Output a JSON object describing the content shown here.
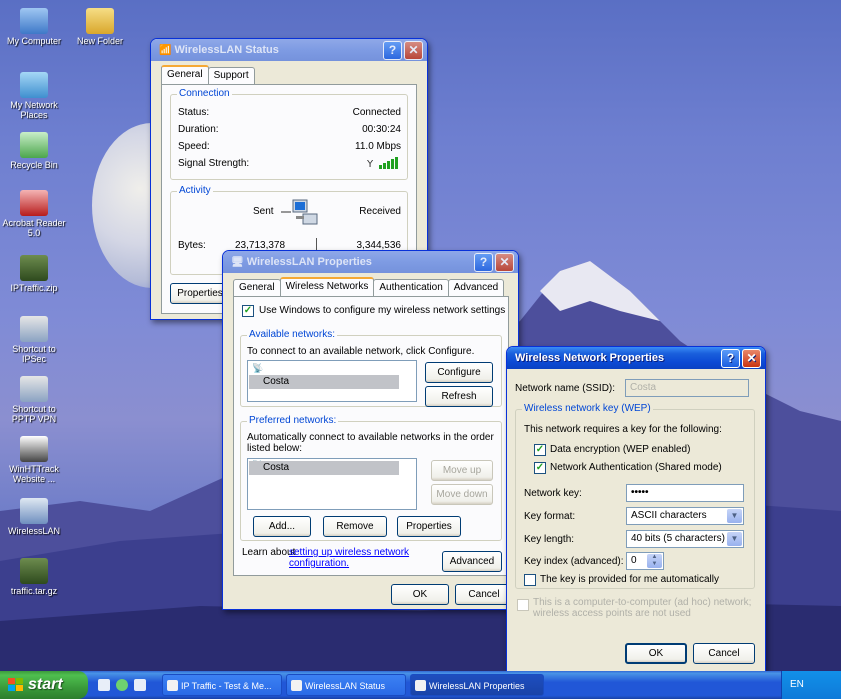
{
  "desktop": {
    "icons": [
      {
        "label": "My Computer"
      },
      {
        "label": "New Folder"
      },
      {
        "label": "My Network Places"
      },
      {
        "label": "Recycle Bin"
      },
      {
        "label": "Acrobat Reader 5.0"
      },
      {
        "label": "IPTraffic.zip"
      },
      {
        "label": "Shortcut to IPSec"
      },
      {
        "label": "Shortcut to PPTP VPN"
      },
      {
        "label": "WinHTTrack Website ..."
      },
      {
        "label": "WirelessLAN"
      },
      {
        "label": "traffic.tar.gz"
      }
    ]
  },
  "status_window": {
    "title": "WirelessLAN Status",
    "tabs": [
      "General",
      "Support"
    ],
    "connection_label": "Connection",
    "rows": [
      {
        "label": "Status:",
        "value": "Connected"
      },
      {
        "label": "Duration:",
        "value": "00:30:24"
      },
      {
        "label": "Speed:",
        "value": "11.0 Mbps"
      },
      {
        "label": "Signal Strength:",
        "value": ""
      }
    ],
    "activity_label": "Activity",
    "sent_label": "Sent",
    "received_label": "Received",
    "bytes_label": "Bytes:",
    "bytes_sent": "23,713,378",
    "bytes_received": "3,344,536",
    "properties_button": "Properties"
  },
  "props_window": {
    "title": "WirelessLAN Properties",
    "tabs": [
      "General",
      "Wireless Networks",
      "Authentication",
      "Advanced"
    ],
    "use_windows_label": "Use Windows to configure my wireless network settings",
    "available_label": "Available networks:",
    "available_text": "To connect to an available network, click Configure.",
    "available_items": [
      "Costa"
    ],
    "configure_button": "Configure",
    "refresh_button": "Refresh",
    "preferred_label": "Preferred networks:",
    "preferred_text": "Automatically connect to available networks in the order listed below:",
    "preferred_items": [
      "Costa"
    ],
    "move_up_button": "Move up",
    "move_down_button": "Move down",
    "add_button": "Add...",
    "remove_button": "Remove",
    "properties_button": "Properties",
    "learn_prefix": "Learn about ",
    "learn_link": "setting up wireless network configuration.",
    "advanced_button": "Advanced",
    "ok_button": "OK",
    "cancel_button": "Cancel"
  },
  "wnp_window": {
    "title": "Wireless Network Properties",
    "ssid_label": "Network name (SSID):",
    "ssid_value": "Costa",
    "wep_group_label": "Wireless network key (WEP)",
    "wep_text": "This network requires a key for the following:",
    "data_encryption_label": "Data encryption (WEP enabled)",
    "network_auth_label": "Network Authentication (Shared mode)",
    "network_key_label": "Network key:",
    "network_key_value": "•••••",
    "key_format_label": "Key format:",
    "key_format_value": "ASCII characters",
    "key_length_label": "Key length:",
    "key_length_value": "40 bits (5 characters)",
    "key_index_label": "Key index (advanced):",
    "key_index_value": "0",
    "auto_key_label": "The key is provided for me automatically",
    "adhoc_label": "This is a computer-to-computer (ad hoc) network; wireless access points are not used",
    "ok_button": "OK",
    "cancel_button": "Cancel"
  },
  "taskbar": {
    "start_label": "start",
    "tasks": [
      {
        "label": "IP Traffic - Test & Me..."
      },
      {
        "label": "WirelessLAN Status"
      },
      {
        "label": "WirelessLAN Properties"
      }
    ],
    "tray_text": "EN"
  }
}
